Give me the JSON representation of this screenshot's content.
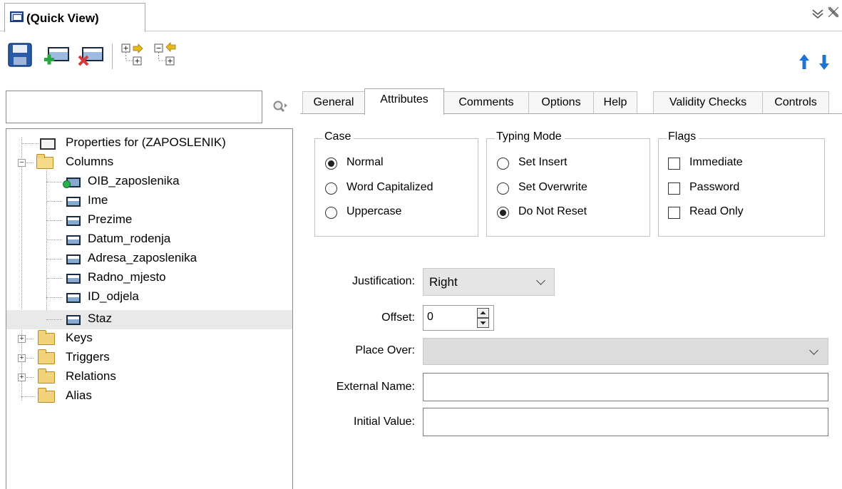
{
  "window": {
    "title": "(Quick View)",
    "title_icon": "window-icon",
    "controls": [
      "chevron-collapse-icon",
      "close-icon"
    ]
  },
  "toolbar": {
    "buttons": [
      "save-icon",
      "add-icon",
      "delete-icon",
      "expand-tree-icon",
      "collapse-tree-icon"
    ],
    "nav": [
      "move-up-icon",
      "move-down-icon"
    ]
  },
  "search": {
    "value": "",
    "icon": "search-icon"
  },
  "tree": {
    "items": [
      {
        "label": "Properties for (ZAPOSLENIK)",
        "icon": "properties-icon"
      },
      {
        "label": "Columns",
        "icon": "folder-open-icon",
        "expanded": true
      },
      {
        "label": "OIB_zaposlenika",
        "icon": "key-column-icon"
      },
      {
        "label": "Ime",
        "icon": "column-icon"
      },
      {
        "label": "Prezime",
        "icon": "column-icon"
      },
      {
        "label": "Datum_rodenja",
        "icon": "column-icon"
      },
      {
        "label": "Adresa_zaposlenika",
        "icon": "column-icon"
      },
      {
        "label": "Radno_mjesto",
        "icon": "column-icon"
      },
      {
        "label": "ID_odjela",
        "icon": "column-icon"
      },
      {
        "label": "Staz",
        "icon": "column-icon",
        "selected": true
      },
      {
        "label": "Keys",
        "icon": "folder-icon"
      },
      {
        "label": "Triggers",
        "icon": "folder-icon"
      },
      {
        "label": "Relations",
        "icon": "folder-icon"
      },
      {
        "label": "Alias",
        "icon": "folder-icon"
      }
    ]
  },
  "tabs": [
    "General",
    "Attributes",
    "Comments",
    "Options",
    "Help",
    "Validity Checks",
    "Controls"
  ],
  "active_tab": "Attributes",
  "case_group": {
    "legend": "Case",
    "options": [
      "Normal",
      "Word Capitalized",
      "Uppercase"
    ],
    "selected": "Normal"
  },
  "typing_group": {
    "legend": "Typing Mode",
    "options": [
      "Set Insert",
      "Set Overwrite",
      "Do Not Reset"
    ],
    "selected": "Do Not Reset"
  },
  "flags_group": {
    "legend": "Flags",
    "options": [
      "Immediate",
      "Password",
      "Read Only"
    ],
    "checked": []
  },
  "form": {
    "justification_label": "Justification:",
    "justification_value": "Right",
    "offset_label": "Offset:",
    "offset_value": "0",
    "place_over_label": "Place Over:",
    "place_over_value": "",
    "external_name_label": "External Name:",
    "external_name_value": "",
    "initial_value_label": "Initial Value:",
    "initial_value_value": ""
  },
  "colors": {
    "nav_arrow": "#1e73d6",
    "save_blue": "#2b5aa8",
    "add_green": "#2aa745",
    "delete_red": "#d83a3a"
  }
}
